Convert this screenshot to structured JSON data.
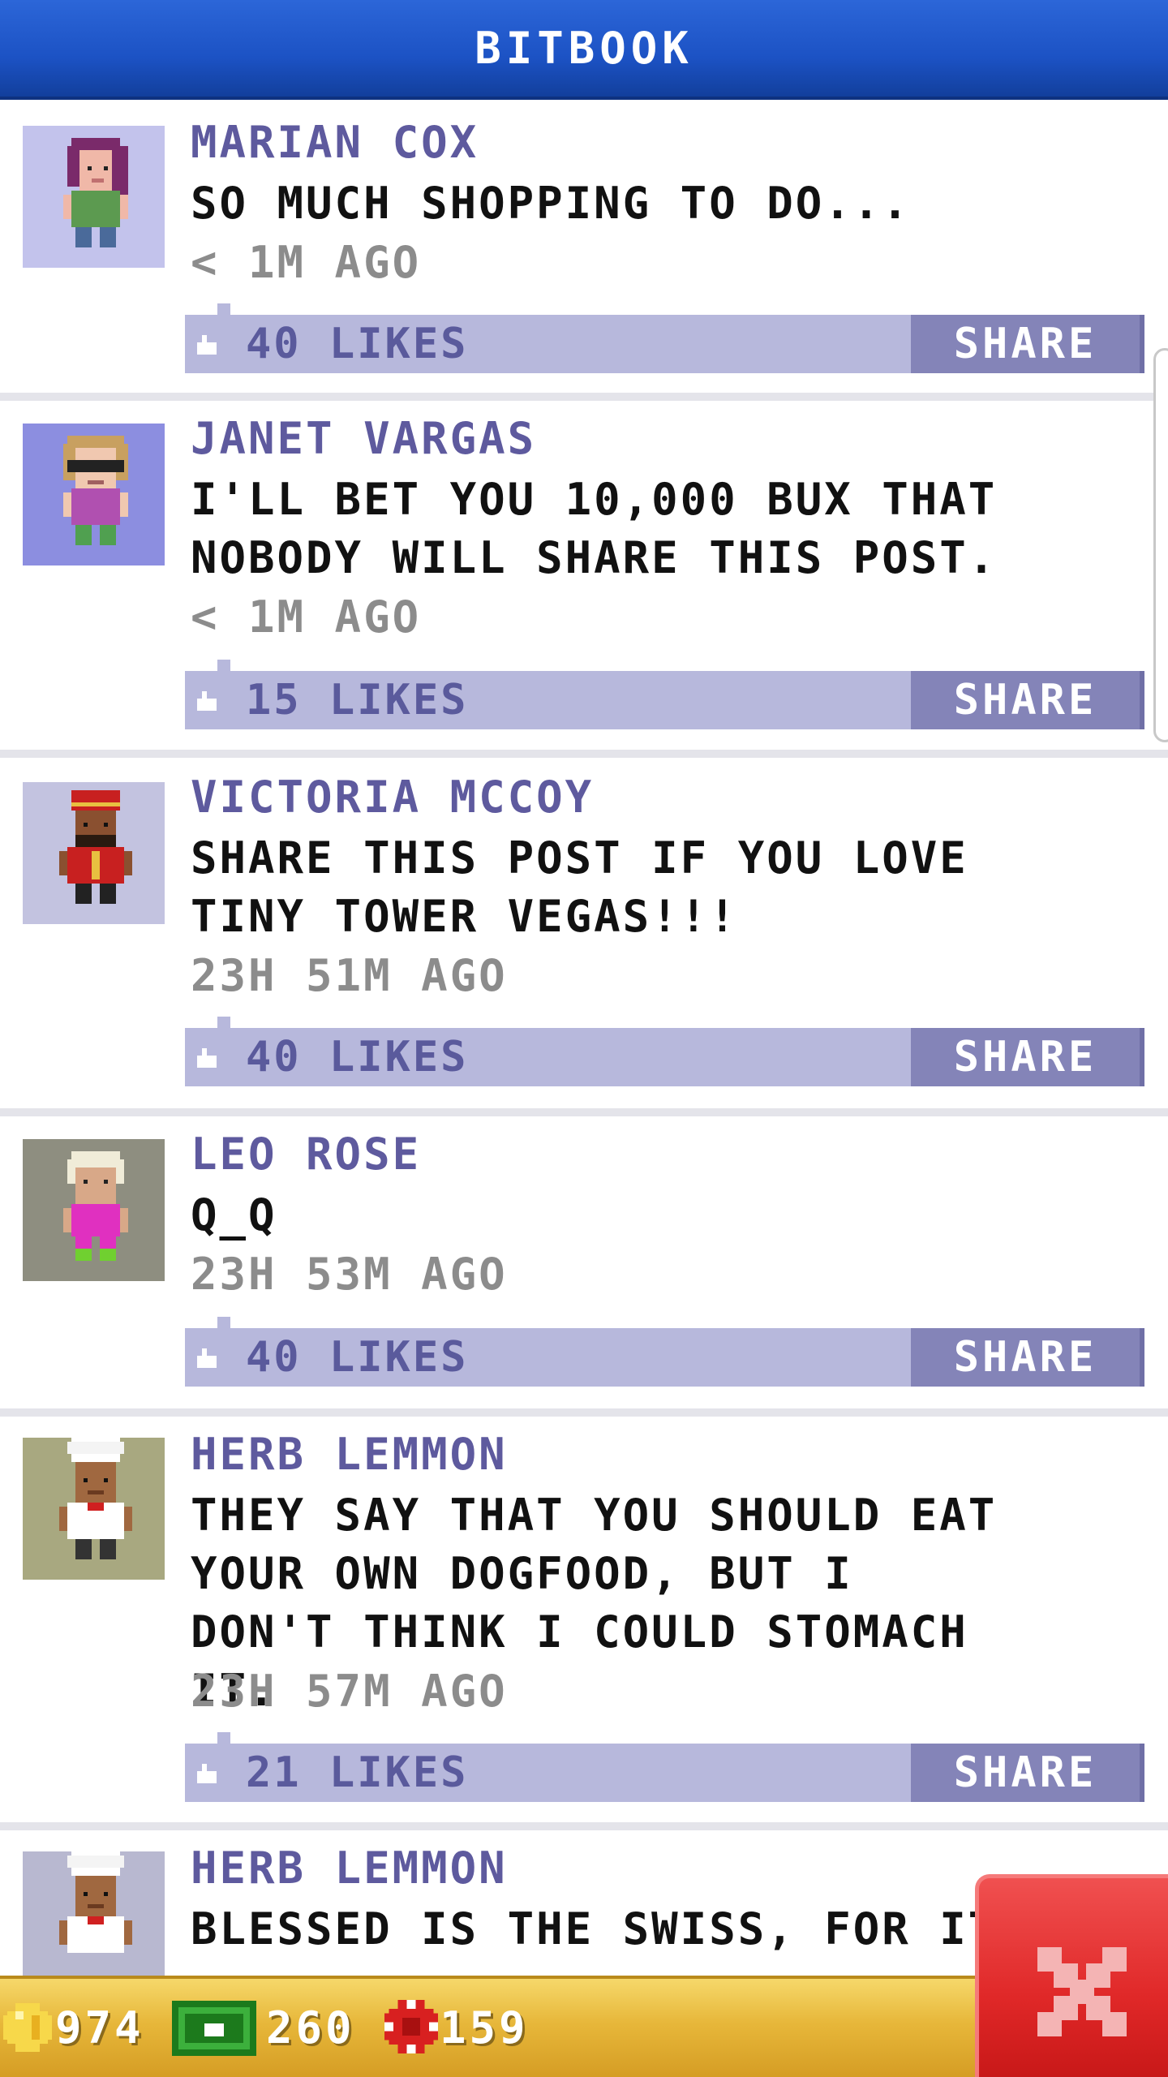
{
  "header": {
    "title": "BITBOOK"
  },
  "posts": [
    {
      "author": "MARIAN COX",
      "message": "SO MUCH SHOPPING TO DO...",
      "time": "< 1M AGO",
      "likes": "40 LIKES",
      "share_label": "SHARE",
      "avatar_bg": "#c3c3ec"
    },
    {
      "author": "JANET VARGAS",
      "message": "I'LL BET YOU 10,000 BUX THAT NOBODY WILL SHARE THIS POST.",
      "time": "< 1M AGO",
      "likes": "15 LIKES",
      "share_label": "SHARE",
      "avatar_bg": "#8c8ee0"
    },
    {
      "author": "VICTORIA MCCOY",
      "message": "SHARE THIS POST IF YOU LOVE TINY TOWER VEGAS!!!",
      "time": "23H 51M AGO",
      "likes": "40 LIKES",
      "share_label": "SHARE",
      "avatar_bg": "#c3c3e0"
    },
    {
      "author": "LEO ROSE",
      "message": "Q_Q",
      "time": "23H 53M AGO",
      "likes": "40 LIKES",
      "share_label": "SHARE",
      "avatar_bg": "#8e8e80"
    },
    {
      "author": "HERB LEMMON",
      "message": "THEY SAY THAT YOU SHOULD EAT YOUR OWN DOGFOOD, BUT I DON'T THINK I COULD STOMACH IT.",
      "time": "23H 57M AGO",
      "likes": "21 LIKES",
      "share_label": "SHARE",
      "avatar_bg": "#a8a880"
    },
    {
      "author": "HERB LEMMON",
      "message": "BLESSED IS THE SWISS, FOR IT IS",
      "avatar_bg": "#b8b8d0"
    }
  ],
  "currency": {
    "coins": "974",
    "bux": "260",
    "chips": "159"
  },
  "colors": {
    "header_blue": "#1c52c4",
    "likes_bar": "#b7b8dc",
    "share_button": "#8484b8",
    "author_text": "#5e5a9e",
    "bottom_bar": "#e7b73a",
    "close_button": "#e02828"
  },
  "icons": {
    "like": "thumbs-up-icon",
    "coin": "coin-icon",
    "bux": "bux-icon",
    "chip": "casino-chip-icon",
    "close": "close-icon"
  }
}
